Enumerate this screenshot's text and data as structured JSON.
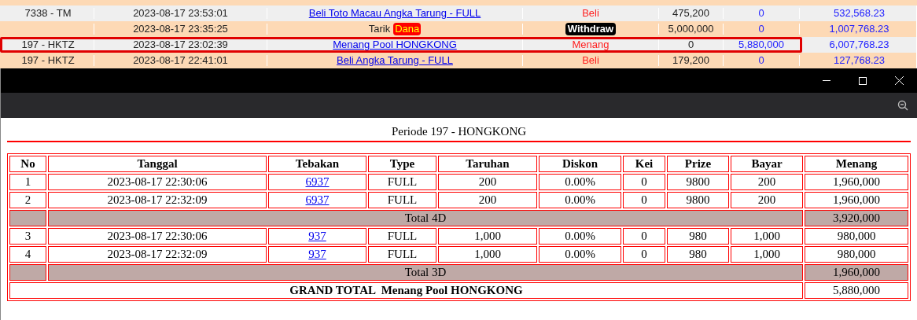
{
  "background_rows": [
    {
      "kind": "bet",
      "code": "7338 - TM",
      "datetime": "2023-08-17 23:53:01",
      "description": "Beli Toto Macau Angka Tarung - FULL",
      "type": "Beli",
      "amount": "475,200",
      "win": "0",
      "balance": "532,568.23",
      "highlighted": false
    },
    {
      "kind": "withdraw",
      "code": "",
      "datetime": "2023-08-17 23:35:25",
      "description": "Tarik",
      "badge": "Dana",
      "type": "Withdraw",
      "amount": "5,000,000",
      "win": "0",
      "balance": "1,007,768.23",
      "highlighted": false
    },
    {
      "kind": "bet",
      "code": "197 - HKTZ",
      "datetime": "2023-08-17 23:02:39",
      "description": "Menang Pool HONGKONG",
      "type": "Menang",
      "amount": "0",
      "win": "5,880,000",
      "balance": "6,007,768.23",
      "highlighted": true
    },
    {
      "kind": "bet",
      "code": "197 - HKTZ",
      "datetime": "2023-08-17 22:41:01",
      "description": "Beli Angka Tarung - FULL",
      "type": "Beli",
      "amount": "179,200",
      "win": "0",
      "balance": "127,768.23",
      "highlighted": false
    }
  ],
  "popup": {
    "title": "Periode 197 - HONGKONG",
    "columns": [
      "No",
      "Tanggal",
      "Tebakan",
      "Type",
      "Taruhan",
      "Diskon",
      "Kei",
      "Prize",
      "Bayar",
      "Menang"
    ],
    "rows": [
      {
        "kind": "entry",
        "cells": [
          "1",
          "2023-08-17 22:30:06",
          "6937",
          "FULL",
          "200",
          "0.00%",
          "0",
          "9800",
          "200",
          "1,960,000"
        ]
      },
      {
        "kind": "entry",
        "cells": [
          "2",
          "2023-08-17 22:32:09",
          "6937",
          "FULL",
          "200",
          "0.00%",
          "0",
          "9800",
          "200",
          "1,960,000"
        ]
      },
      {
        "kind": "subtotal",
        "label": "Total 4D",
        "value": "3,920,000"
      },
      {
        "kind": "entry",
        "cells": [
          "3",
          "2023-08-17 22:30:06",
          "937",
          "FULL",
          "1,000",
          "0.00%",
          "0",
          "980",
          "1,000",
          "980,000"
        ]
      },
      {
        "kind": "entry",
        "cells": [
          "4",
          "2023-08-17 22:32:09",
          "937",
          "FULL",
          "1,000",
          "0.00%",
          "0",
          "980",
          "1,000",
          "980,000"
        ]
      },
      {
        "kind": "subtotal",
        "label": "Total 3D",
        "value": "1,960,000"
      },
      {
        "kind": "grand_total",
        "label": "GRAND TOTAL  Menang Pool HONGKONG",
        "value": "5,880,000"
      }
    ]
  }
}
